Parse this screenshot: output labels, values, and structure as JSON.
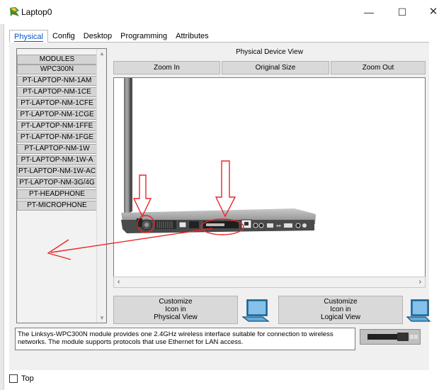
{
  "window": {
    "title": "Laptop0",
    "minimize_glyph": "—",
    "maximize_glyph": "☐",
    "close_glyph": "✕"
  },
  "tabs": [
    {
      "label": "Physical",
      "active": true
    },
    {
      "label": "Config",
      "active": false
    },
    {
      "label": "Desktop",
      "active": false
    },
    {
      "label": "Programming",
      "active": false
    },
    {
      "label": "Attributes",
      "active": false
    }
  ],
  "modules": {
    "header": "MODULES",
    "items": [
      "WPC300N",
      "PT-LAPTOP-NM-1AM",
      "PT-LAPTOP-NM-1CE",
      "PT-LAPTOP-NM-1CFE",
      "PT-LAPTOP-NM-1CGE",
      "PT-LAPTOP-NM-1FFE",
      "PT-LAPTOP-NM-1FGE",
      "PT-LAPTOP-NM-1W",
      "PT-LAPTOP-NM-1W-A",
      "PT-LAPTOP-NM-1W-AC",
      "PT-LAPTOP-NM-3G/4G",
      "PT-HEADPHONE",
      "PT-MICROPHONE"
    ]
  },
  "device_view": {
    "title": "Physical Device View",
    "zoom_in": "Zoom In",
    "original_size": "Original Size",
    "zoom_out": "Zoom Out"
  },
  "customize": {
    "physical": [
      "Customize",
      "Icon in",
      "Physical View"
    ],
    "logical": [
      "Customize",
      "Icon in",
      "Logical View"
    ]
  },
  "description": "The Linksys-WPC300N module provides one 2.4GHz wireless interface suitable for connection to wireless networks. The module supports protocols that use Ethernet for LAN access.",
  "top_checkbox": {
    "label": "Top",
    "checked": false
  },
  "colors": {
    "annotation": "#e8262b",
    "active_tab": "#0b57c9",
    "laptop_body": "#a9a9a9",
    "laptop_icon": "#2e86c1"
  }
}
